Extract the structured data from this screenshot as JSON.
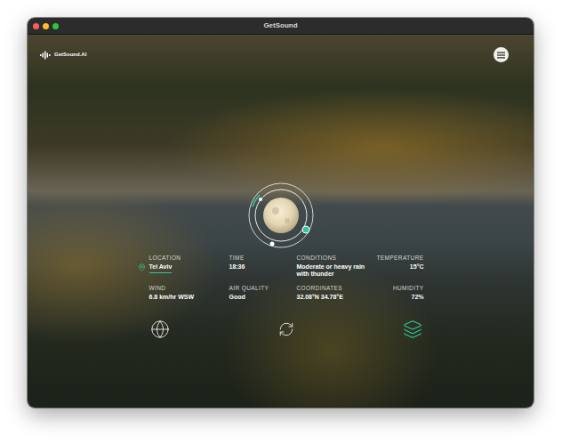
{
  "window": {
    "title": "GetSound"
  },
  "logo": {
    "name": "GetSound.AI"
  },
  "weather": {
    "fields": [
      {
        "label": "LOCATION",
        "value": "Tel Aviv",
        "kind": "location"
      },
      {
        "label": "TIME",
        "value": "18:36",
        "kind": "plain"
      },
      {
        "label": "CONDITIONS",
        "value": "Moderate or heavy rain with thunder",
        "kind": "plain"
      },
      {
        "label": "TEMPERATURE",
        "value": "15°C",
        "kind": "plain"
      },
      {
        "label": "WIND",
        "value": "6.8 km/hr WSW",
        "kind": "plain"
      },
      {
        "label": "AIR QUALITY",
        "value": "Good",
        "kind": "plain"
      },
      {
        "label": "COORDINATES",
        "value": "32.08°N 34.78°E",
        "kind": "plain"
      },
      {
        "label": "HUMIDITY",
        "value": "72%",
        "kind": "plain"
      }
    ]
  },
  "actions": [
    {
      "kind": "globe",
      "selected": false
    },
    {
      "kind": "refresh",
      "selected": false
    },
    {
      "kind": "layers",
      "selected": true
    }
  ]
}
